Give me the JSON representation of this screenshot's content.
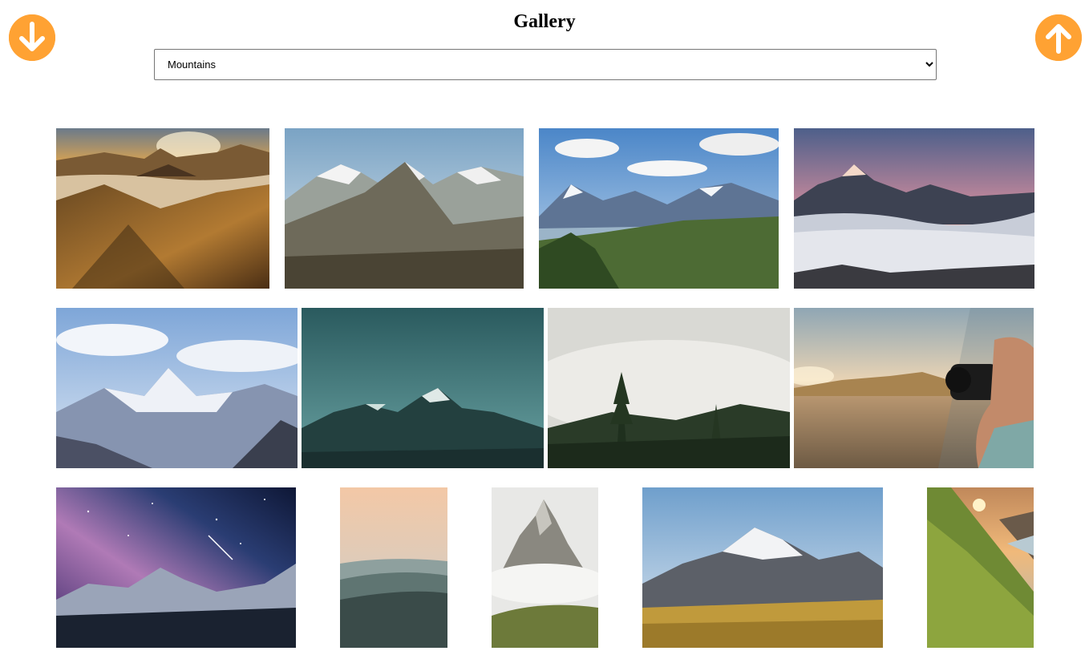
{
  "page": {
    "title": "Gallery"
  },
  "category_select": {
    "selected": "Mountains",
    "options": [
      "Mountains"
    ]
  },
  "buttons": {
    "scroll_down_icon": "arrow-down-icon",
    "scroll_up_icon": "arrow-up-icon",
    "accent_color": "#ffa233"
  },
  "gallery": {
    "rows": [
      [
        {
          "subject": "desert-mountains-sunset"
        },
        {
          "subject": "rocky-peaks"
        },
        {
          "subject": "valley-forest-peaks"
        },
        {
          "subject": "peak-above-clouds"
        }
      ],
      [
        {
          "subject": "snowy-himalaya"
        },
        {
          "subject": "teal-night-peaks"
        },
        {
          "subject": "misty-forest"
        },
        {
          "subject": "photographer-desert"
        }
      ],
      [
        {
          "subject": "milky-way-mountains"
        },
        {
          "subject": "hazy-ridges"
        },
        {
          "subject": "spire-in-clouds"
        },
        {
          "subject": "snowy-peak-meadow"
        },
        {
          "subject": "sunlit-green-slope"
        }
      ]
    ]
  }
}
